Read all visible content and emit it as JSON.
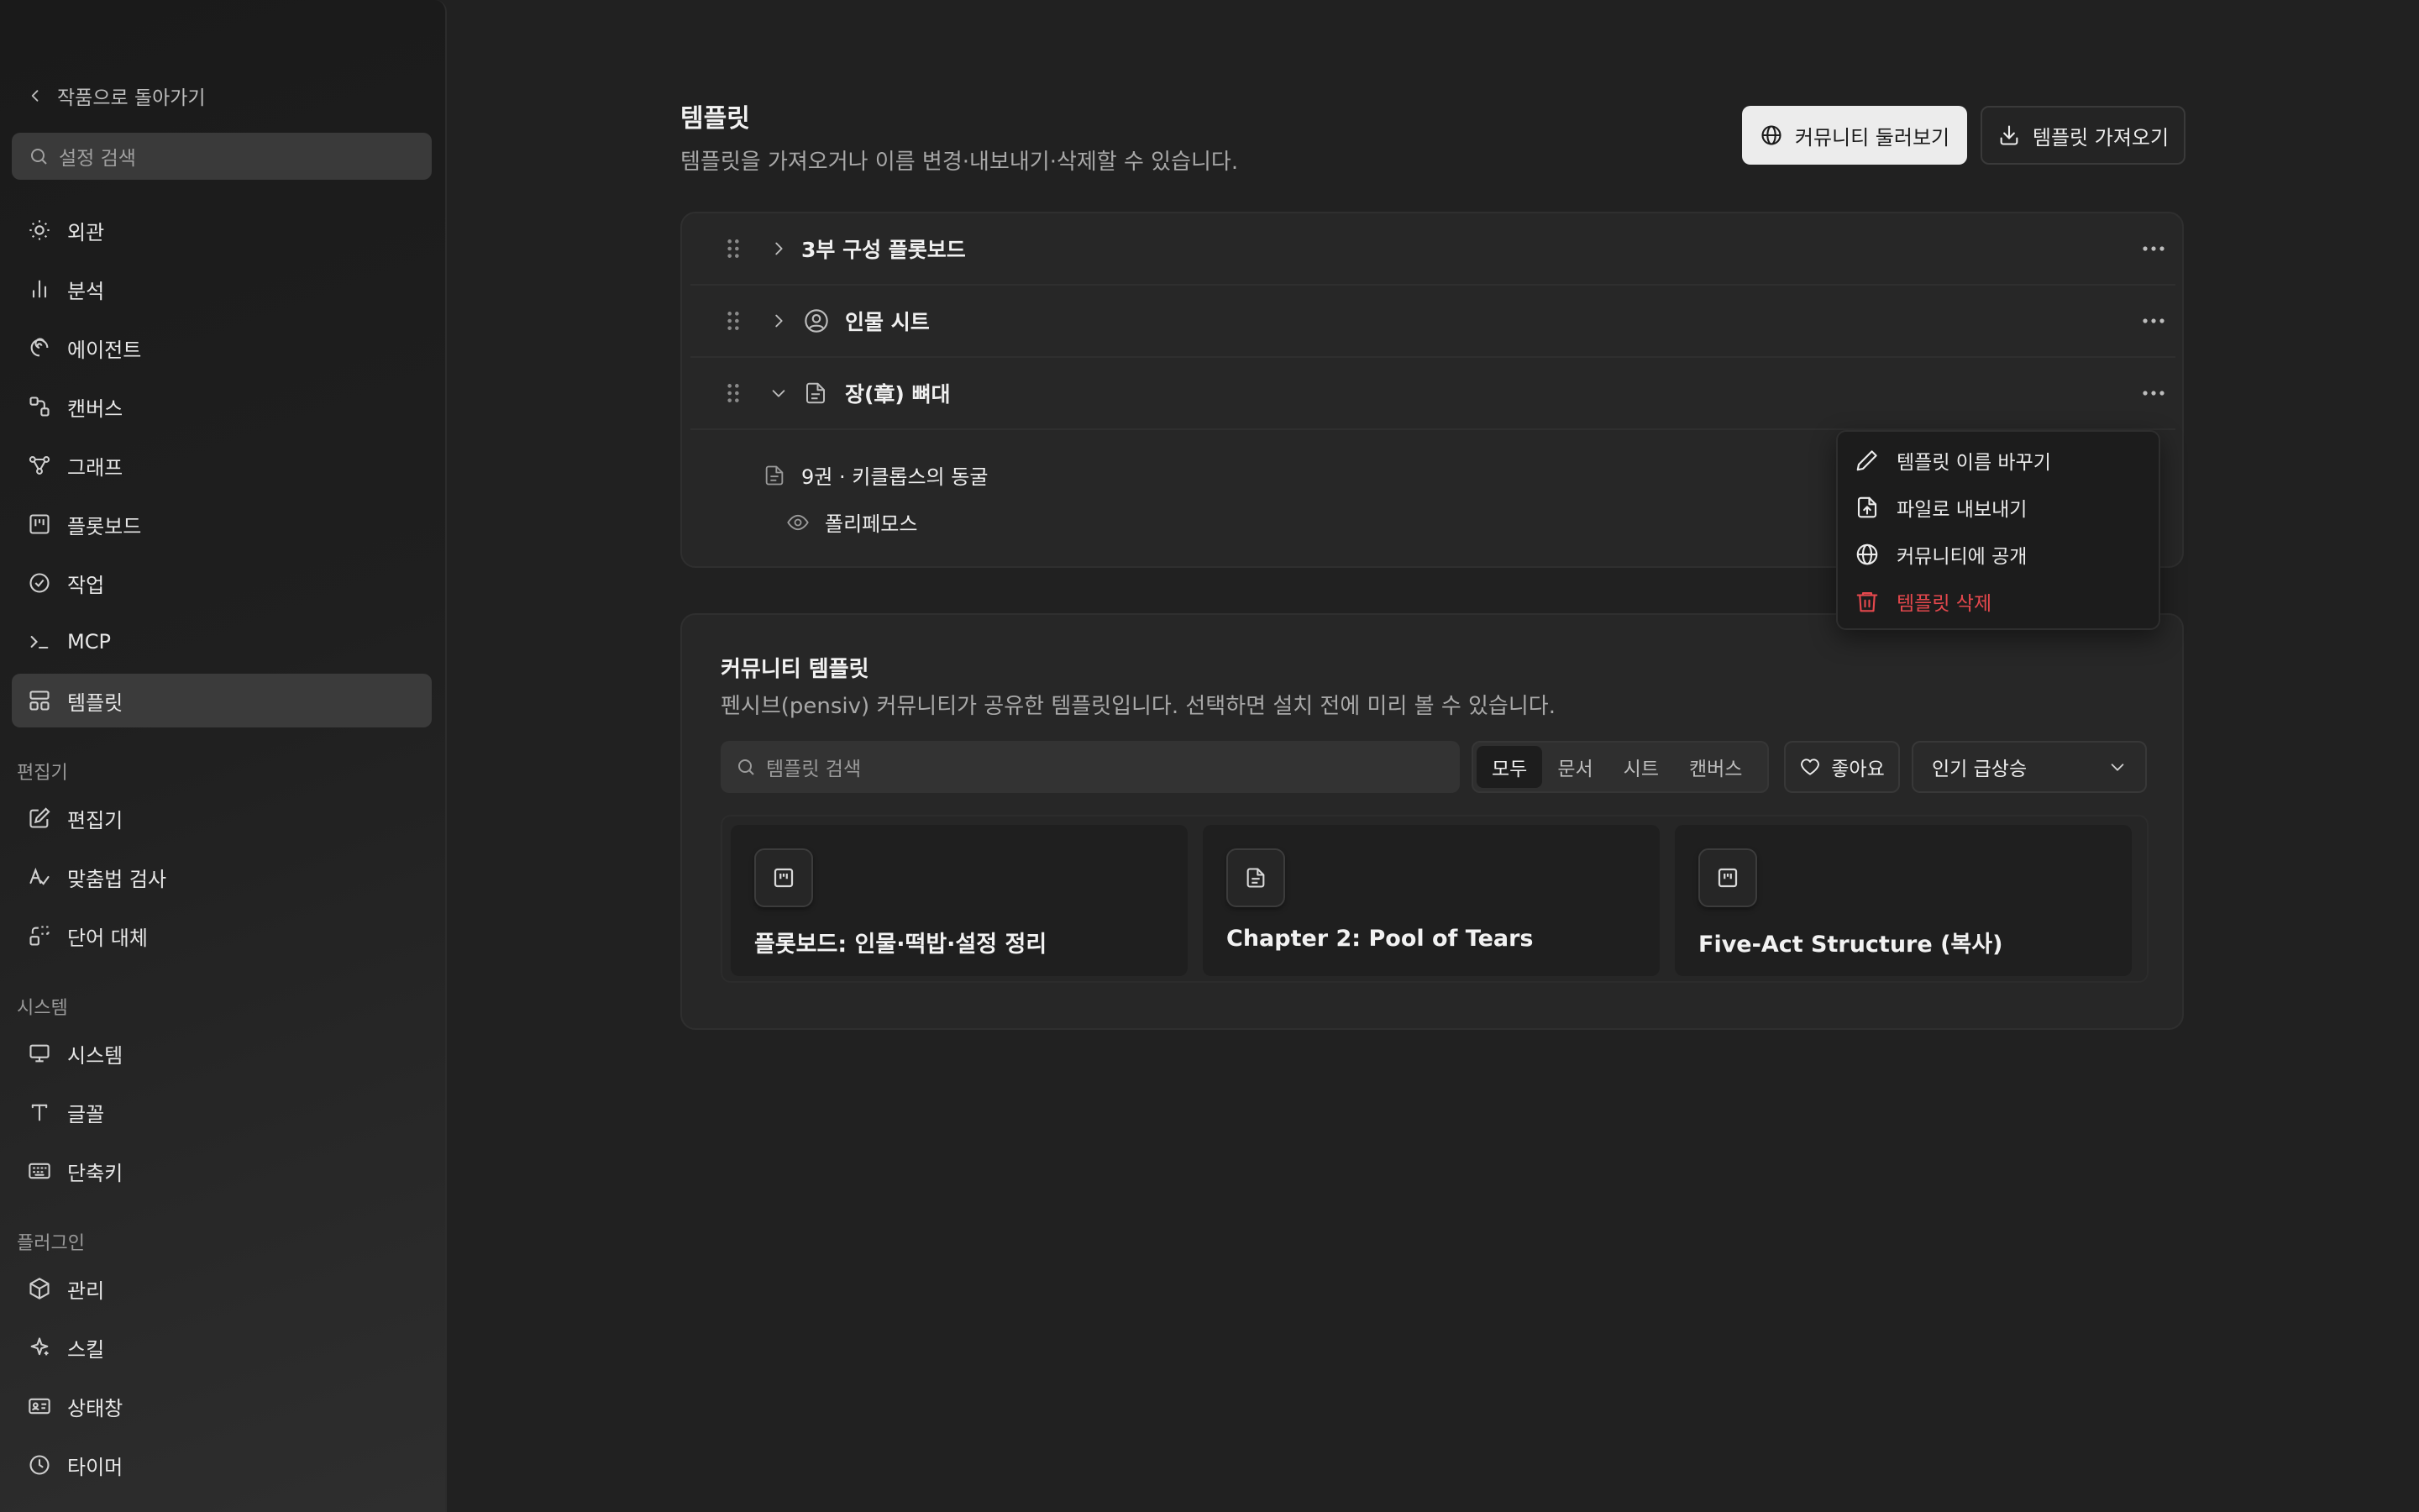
{
  "sidebar": {
    "back_label": "작품으로 돌아가기",
    "search_placeholder": "설정 검색",
    "items": [
      {
        "label": "외관",
        "icon": "sun-icon"
      },
      {
        "label": "분석",
        "icon": "bar-chart-icon"
      },
      {
        "label": "에이전트",
        "icon": "spiral-icon"
      },
      {
        "label": "캔버스",
        "icon": "canvas-icon"
      },
      {
        "label": "그래프",
        "icon": "graph-icon"
      },
      {
        "label": "플롯보드",
        "icon": "board-icon"
      },
      {
        "label": "작업",
        "icon": "check-circle-icon"
      },
      {
        "label": "MCP",
        "icon": "terminal-icon"
      },
      {
        "label": "템플릿",
        "icon": "template-icon"
      }
    ],
    "editor_section": "편집기",
    "editor_items": [
      {
        "label": "편집기",
        "icon": "edit-icon"
      },
      {
        "label": "맞춤법 검사",
        "icon": "spellcheck-icon"
      },
      {
        "label": "단어 대체",
        "icon": "replace-icon"
      }
    ],
    "system_section": "시스템",
    "system_items": [
      {
        "label": "시스템",
        "icon": "monitor-icon"
      },
      {
        "label": "글꼴",
        "icon": "type-icon"
      },
      {
        "label": "단축키",
        "icon": "keyboard-icon"
      }
    ],
    "plugin_section": "플러그인",
    "plugin_items": [
      {
        "label": "관리",
        "icon": "box-icon"
      },
      {
        "label": "스킬",
        "icon": "sparkle-icon"
      },
      {
        "label": "상태창",
        "icon": "id-card-icon"
      },
      {
        "label": "타이머",
        "icon": "clock-icon"
      }
    ]
  },
  "main": {
    "title": "템플릿",
    "description": "템플릿을 가져오거나 이름 변경·내보내기·삭제할 수 있습니다.",
    "browse_community_label": "커뮤니티 둘러보기",
    "import_label": "템플릿 가져오기",
    "templates": [
      {
        "name": "3부 구성 플롯보드",
        "expanded": false
      },
      {
        "name": "인물 시트",
        "expanded": false
      },
      {
        "name": "장(章) 뼈대",
        "expanded": true
      }
    ],
    "children": [
      {
        "label": "9권 · 키클롭스의 동굴"
      },
      {
        "label": "폴리페모스"
      }
    ],
    "context_menu": {
      "rename": "템플릿 이름 바꾸기",
      "export": "파일로 내보내기",
      "publish": "커뮤니티에 공개",
      "delete": "템플릿 삭제"
    },
    "community": {
      "title": "커뮤니티 템플릿",
      "description": "펜시브(pensiv) 커뮤니티가 공유한 템플릿입니다. 선택하면 설치 전에 미리 볼 수 있습니다.",
      "search_placeholder": "템플릿 검색",
      "filters": [
        "모두",
        "문서",
        "시트",
        "캔버스"
      ],
      "active_filter": "모두",
      "like_label": "좋아요",
      "sort_label": "인기 급상승",
      "cards": [
        {
          "name": "플롯보드: 인물·떡밥·설정 정리",
          "icon": "board-icon"
        },
        {
          "name": "Chapter 2: Pool of Tears",
          "icon": "document-icon"
        },
        {
          "name": "Five-Act Structure (복사)",
          "icon": "board-icon"
        }
      ]
    }
  },
  "colors": {
    "background": "#212121",
    "danger": "#e5484d",
    "primary_button": "#ececec"
  }
}
